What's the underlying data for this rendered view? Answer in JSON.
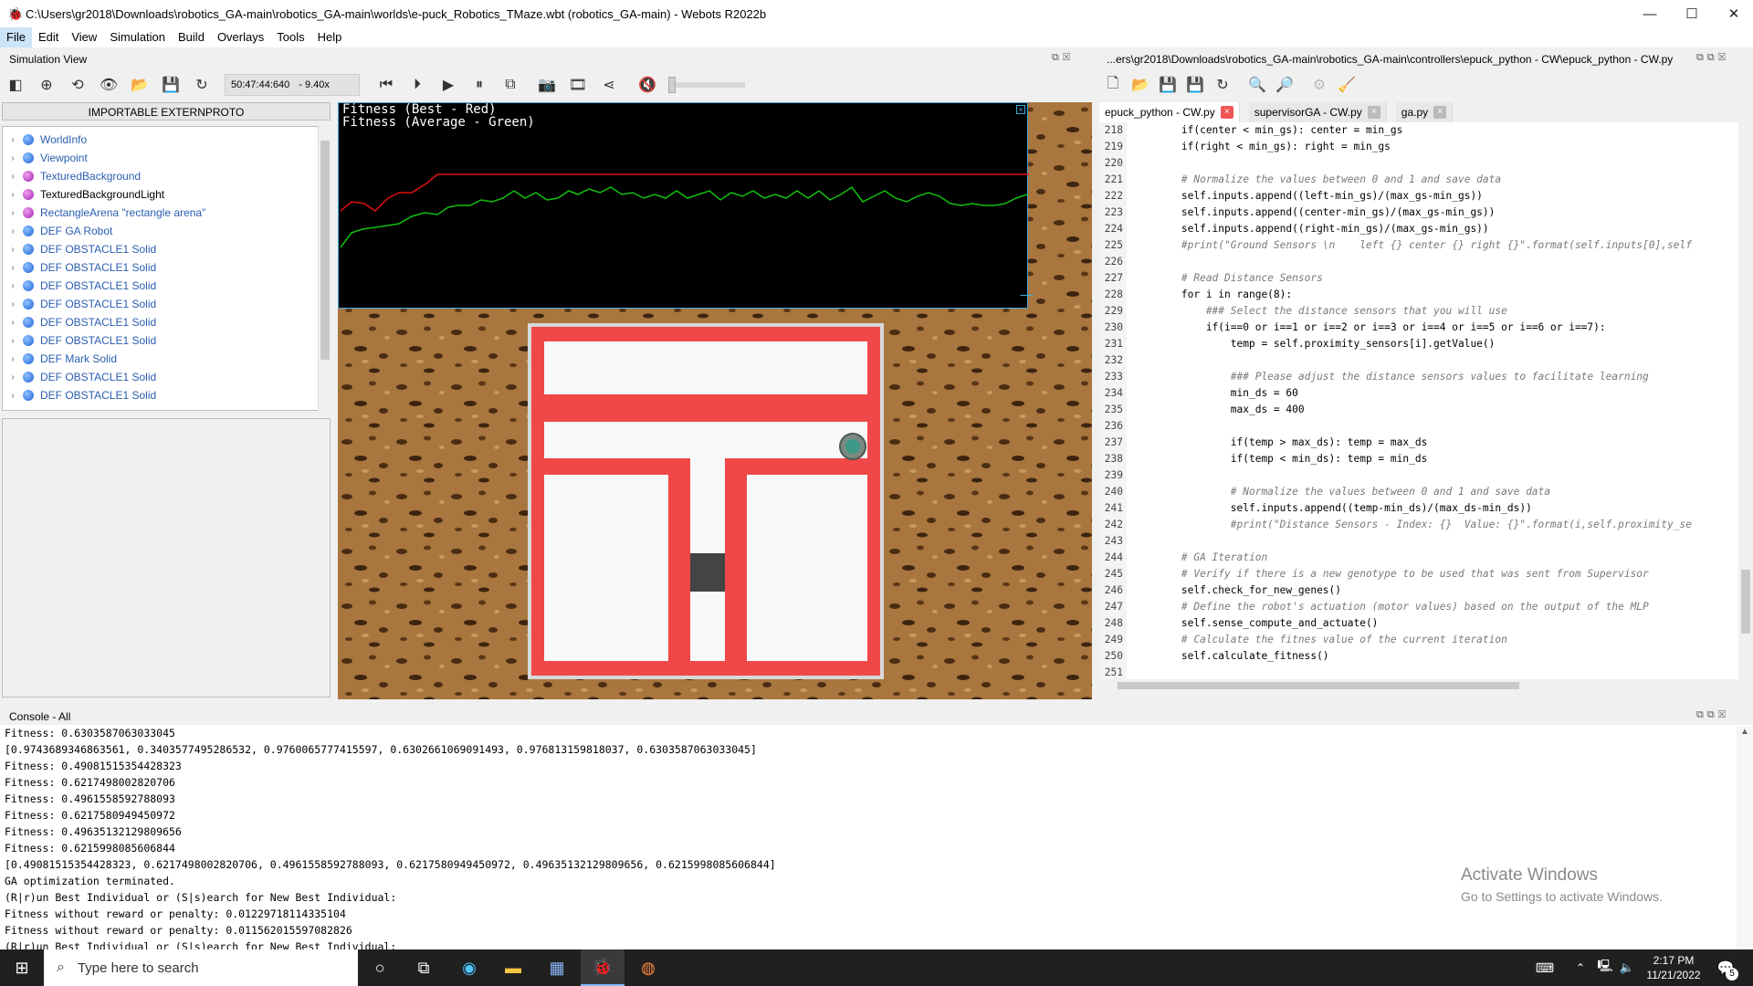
{
  "window": {
    "title": "C:\\Users\\gr2018\\Downloads\\robotics_GA-main\\robotics_GA-main\\worlds\\e-puck_Robotics_TMaze.wbt (robotics_GA-main) - Webots R2022b",
    "minimize": "—",
    "maximize": "☐",
    "close": "✕"
  },
  "menu": [
    "File",
    "Edit",
    "View",
    "Simulation",
    "Build",
    "Overlays",
    "Tools",
    "Help"
  ],
  "simulation_view": {
    "title": "Simulation View",
    "time": "50:47:44:640",
    "speed": "- 9.40x"
  },
  "scene_tree": {
    "header": "IMPORTABLE EXTERNPROTO",
    "nodes": [
      {
        "label": "WorldInfo",
        "color": "blue"
      },
      {
        "label": "Viewpoint",
        "color": "blue"
      },
      {
        "label": "TexturedBackground",
        "color": "purple"
      },
      {
        "label": "TexturedBackgroundLight",
        "color": "purple",
        "black": true
      },
      {
        "label": "RectangleArena \"rectangle arena\"",
        "color": "purple"
      },
      {
        "label": "DEF GA Robot",
        "color": "blue"
      },
      {
        "label": "DEF OBSTACLE1 Solid",
        "color": "blue"
      },
      {
        "label": "DEF OBSTACLE1 Solid",
        "color": "blue"
      },
      {
        "label": "DEF OBSTACLE1 Solid",
        "color": "blue"
      },
      {
        "label": "DEF OBSTACLE1 Solid",
        "color": "blue"
      },
      {
        "label": "DEF OBSTACLE1 Solid",
        "color": "blue"
      },
      {
        "label": "DEF OBSTACLE1 Solid",
        "color": "blue"
      },
      {
        "label": "DEF Mark Solid",
        "color": "blue"
      },
      {
        "label": "DEF OBSTACLE1 Solid",
        "color": "blue"
      },
      {
        "label": "DEF OBSTACLE1 Solid",
        "color": "blue"
      }
    ]
  },
  "graph": {
    "line1": "Fitness (Best - Red)",
    "line2": "Fitness (Average - Green)"
  },
  "editor": {
    "title": "...ers\\gr2018\\Downloads\\robotics_GA-main\\robotics_GA-main\\controllers\\epuck_python - CW\\epuck_python - CW.py",
    "tabs": [
      {
        "label": "epuck_python - CW.py",
        "active": true
      },
      {
        "label": "supervisorGA - CW.py",
        "active": false
      },
      {
        "label": "ga.py",
        "active": false
      }
    ],
    "lines": [
      {
        "n": "218",
        "t": "        if(center < min_gs): center = min_gs"
      },
      {
        "n": "219",
        "t": "        if(right < min_gs): right = min_gs"
      },
      {
        "n": "220",
        "t": ""
      },
      {
        "n": "221",
        "t": "        # Normalize the values between 0 and 1 and save data"
      },
      {
        "n": "222",
        "t": "        self.inputs.append((left-min_gs)/(max_gs-min_gs))"
      },
      {
        "n": "223",
        "t": "        self.inputs.append((center-min_gs)/(max_gs-min_gs))"
      },
      {
        "n": "224",
        "t": "        self.inputs.append((right-min_gs)/(max_gs-min_gs))"
      },
      {
        "n": "225",
        "t": "        #print(\"Ground Sensors \\n    left {} center {} right {}\".format(self.inputs[0],self"
      },
      {
        "n": "226",
        "t": ""
      },
      {
        "n": "227",
        "t": "        # Read Distance Sensors"
      },
      {
        "n": "228",
        "t": "        for i in range(8):"
      },
      {
        "n": "229",
        "t": "            ### Select the distance sensors that you will use"
      },
      {
        "n": "230",
        "t": "            if(i==0 or i==1 or i==2 or i==3 or i==4 or i==5 or i==6 or i==7):"
      },
      {
        "n": "231",
        "t": "                temp = self.proximity_sensors[i].getValue()"
      },
      {
        "n": "232",
        "t": ""
      },
      {
        "n": "233",
        "t": "                ### Please adjust the distance sensors values to facilitate learning"
      },
      {
        "n": "234",
        "t": "                min_ds = 60"
      },
      {
        "n": "235",
        "t": "                max_ds = 400"
      },
      {
        "n": "236",
        "t": ""
      },
      {
        "n": "237",
        "t": "                if(temp > max_ds): temp = max_ds"
      },
      {
        "n": "238",
        "t": "                if(temp < min_ds): temp = min_ds"
      },
      {
        "n": "239",
        "t": ""
      },
      {
        "n": "240",
        "t": "                # Normalize the values between 0 and 1 and save data"
      },
      {
        "n": "241",
        "t": "                self.inputs.append((temp-min_ds)/(max_ds-min_ds))"
      },
      {
        "n": "242",
        "t": "                #print(\"Distance Sensors - Index: {}  Value: {}\".format(i,self.proximity_se"
      },
      {
        "n": "243",
        "t": ""
      },
      {
        "n": "244",
        "t": "        # GA Iteration"
      },
      {
        "n": "245",
        "t": "        # Verify if there is a new genotype to be used that was sent from Supervisor"
      },
      {
        "n": "246",
        "t": "        self.check_for_new_genes()"
      },
      {
        "n": "247",
        "t": "        # Define the robot's actuation (motor values) based on the output of the MLP"
      },
      {
        "n": "248",
        "t": "        self.sense_compute_and_actuate()"
      },
      {
        "n": "249",
        "t": "        # Calculate the fitnes value of the current iteration"
      },
      {
        "n": "250",
        "t": "        self.calculate_fitness()"
      },
      {
        "n": "251",
        "t": ""
      }
    ]
  },
  "console": {
    "title": "Console - All",
    "lines": [
      "Fitness: 0.6303587063033045",
      "[0.9743689346863561, 0.3403577495286532, 0.9760065777415597, 0.6302661069091493, 0.976813159818037, 0.6303587063033045]",
      "Fitness: 0.49081515354428323",
      "Fitness: 0.6217498002820706",
      "Fitness: 0.4961558592788093",
      "Fitness: 0.6217580949450972",
      "Fitness: 0.49635132129809656",
      "Fitness: 0.6215998085606844",
      "[0.49081515354428323, 0.6217498002820706, 0.4961558592788093, 0.6217580949450972, 0.49635132129809656, 0.6215998085606844]",
      "GA optimization terminated.",
      "(R|r)un Best Individual or (S|s)earch for New Best Individual:",
      "Fitness without reward or penalty: 0.01229718114335104",
      "Fitness without reward or penalty: 0.011562015597082826",
      "(R|r)un Best Individual or (S|s)earch for New Best Individual:"
    ]
  },
  "watermark": {
    "line1": "Activate Windows",
    "line2": "Go to Settings to activate Windows."
  },
  "taskbar": {
    "search_placeholder": "Type here to search",
    "time": "2:17 PM",
    "date": "11/21/2022",
    "notifications": "5"
  }
}
